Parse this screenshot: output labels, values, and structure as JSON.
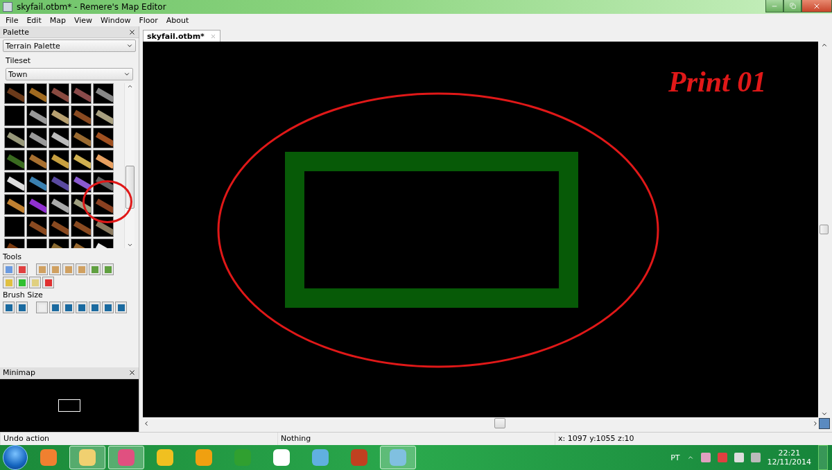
{
  "window": {
    "title": "skyfail.otbm* - Remere's Map Editor"
  },
  "menu": [
    "File",
    "Edit",
    "Map",
    "View",
    "Window",
    "Floor",
    "About"
  ],
  "palette": {
    "title": "Palette",
    "palette_type": "Terrain Palette",
    "tileset_label": "Tileset",
    "tileset": "Town",
    "tools_label": "Tools",
    "brush_size_label": "Brush Size"
  },
  "minimap": {
    "title": "Minimap"
  },
  "tabs": [
    {
      "label": "skyfail.otbm*",
      "selected": true
    }
  ],
  "canvas": {
    "annotation": "Print 01"
  },
  "status_bar": [
    "Undo action",
    "Nothing",
    "x: 1097 y:1055 z:10"
  ],
  "taskbar": {
    "apps": [
      {
        "active": false
      },
      {
        "active": true
      },
      {
        "active": true
      },
      {
        "active": false
      },
      {
        "active": false
      },
      {
        "active": false
      },
      {
        "active": false
      },
      {
        "active": false
      },
      {
        "active": false
      },
      {
        "active": true
      }
    ],
    "language": "PT",
    "time": "22:21",
    "date": "12/11/2014"
  }
}
